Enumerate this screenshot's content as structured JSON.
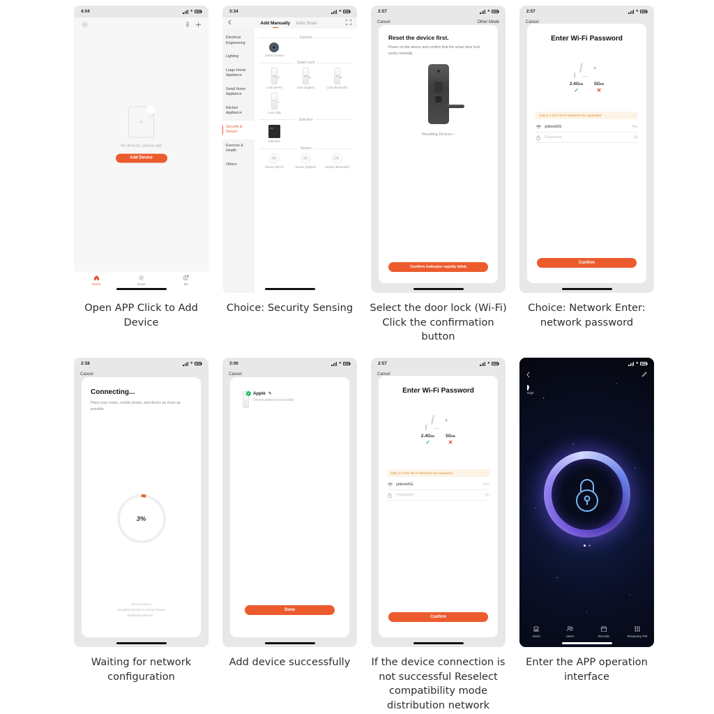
{
  "steps": [
    {
      "caption": "Open APP Click to Add Device",
      "status": {
        "time": "4:04",
        "loc": "➤"
      },
      "empty_text": "No devices, please add",
      "add_button": "Add Device",
      "tabs": [
        {
          "label": "Home",
          "icon": "home-icon"
        },
        {
          "label": "Smart",
          "icon": "sun-icon"
        },
        {
          "label": "Me",
          "icon": "profile-icon"
        }
      ]
    },
    {
      "caption": "Choice: Security Sensing",
      "status": {
        "time": "3:34"
      },
      "tab_manual": "Add Manually",
      "tab_auto": "Auto Scan",
      "categories": [
        "Electrical Engineering",
        "Lighting",
        "Large Home Appliance",
        "Small Home Appliance",
        "Kitchen Appliance",
        "Security & Sensor",
        "Exercise & Health",
        "Others"
      ],
      "active_category": "Security & Sensor",
      "sections": [
        {
          "title": "Camera",
          "items": [
            "Smart Camera"
          ]
        },
        {
          "title": "Smart Lock",
          "items": [
            "Lock (Wi-Fi)",
            "Lock (Zigbee)",
            "Lock (Bluetooth)",
            "Lock (NB)"
          ]
        },
        {
          "title": "Safe Box",
          "items": [
            "Safe Box"
          ]
        },
        {
          "title": "Sensor",
          "items": [
            "Sensor (Wi-Fi)",
            "Sensor (Zigbee)",
            "Sensor (Bluetooth)"
          ]
        }
      ]
    },
    {
      "caption": "Select the door lock (Wi-Fi) Click the confirmation button",
      "status": {
        "time": "2:57"
      },
      "cancel": "Cancel",
      "other_mode": "Other Mode",
      "title": "Reset the device first.",
      "subtitle": "Power on the device and confirm that the smart door lock works normally",
      "reset_link": "Resetting Devices ›",
      "confirm_button": "Confirm indicator rapidly blink"
    },
    {
      "caption": "Choice: Network Enter: network password",
      "status": {
        "time": "2:57"
      },
      "cancel": "Cancel",
      "title": "Enter Wi-Fi Password",
      "freq_24": "2.4G",
      "freq_24_unit": "Hz",
      "freq_5": "5G",
      "freq_5_unit": "Hz",
      "mark_ok": "✓",
      "mark_no": "✕",
      "notice": "Only 2.4 GHz Wi-Fi networks are supported",
      "notice_arrow": "›",
      "ssid": "ytxlock5G",
      "ssid_tail": "Anu",
      "password_placeholder": "Password",
      "confirm_button": "Confirm"
    },
    {
      "caption": "Waiting for network configuration",
      "status": {
        "time": "2:58"
      },
      "cancel": "Cancel",
      "title": "Connecting...",
      "subtitle": "Place your router, mobile phone, and device as close as possible",
      "progress": "3%",
      "progress_value": 3,
      "log": [
        "Device found",
        "Register Device to Smart Cloud",
        "Initializing device..."
      ]
    },
    {
      "caption": "Add device successfully",
      "status": {
        "time": "3:06"
      },
      "cancel": "Cancel",
      "device_name": "Apple",
      "device_status": "Device added successfully",
      "done_button": "Done"
    },
    {
      "caption": "If the device connection is not successful Reselect compatibility mode distribution network",
      "status": {
        "time": "2:57"
      },
      "cancel": "Cancel",
      "title": "Enter Wi-Fi Password",
      "freq_24": "2.4G",
      "freq_24_unit": "Hz",
      "freq_5": "5G",
      "freq_5_unit": "Hz",
      "mark_ok": "✓",
      "mark_no": "✕",
      "notice": "Only 2.4 GHz Wi-Fi networks are supported",
      "notice_arrow": "›",
      "ssid": "ytxlock5G",
      "ssid_tail": "Anu",
      "password_placeholder": "Password",
      "confirm_button": "Confirm"
    },
    {
      "caption": "Enter the APP operation interface",
      "battery_label": "High",
      "tabs": [
        {
          "label": "Alarm",
          "icon": "alarm-icon"
        },
        {
          "label": "Users",
          "icon": "users-icon"
        },
        {
          "label": "Records",
          "icon": "calendar-icon"
        },
        {
          "label": "Temporary PW",
          "icon": "keypad-icon"
        }
      ]
    }
  ],
  "colors": {
    "accent": "#ec5b2d",
    "ok": "#3bb54a",
    "error": "#e03b3b",
    "notice_bg": "#fdf3e6",
    "notice_text": "#d98b2b"
  }
}
